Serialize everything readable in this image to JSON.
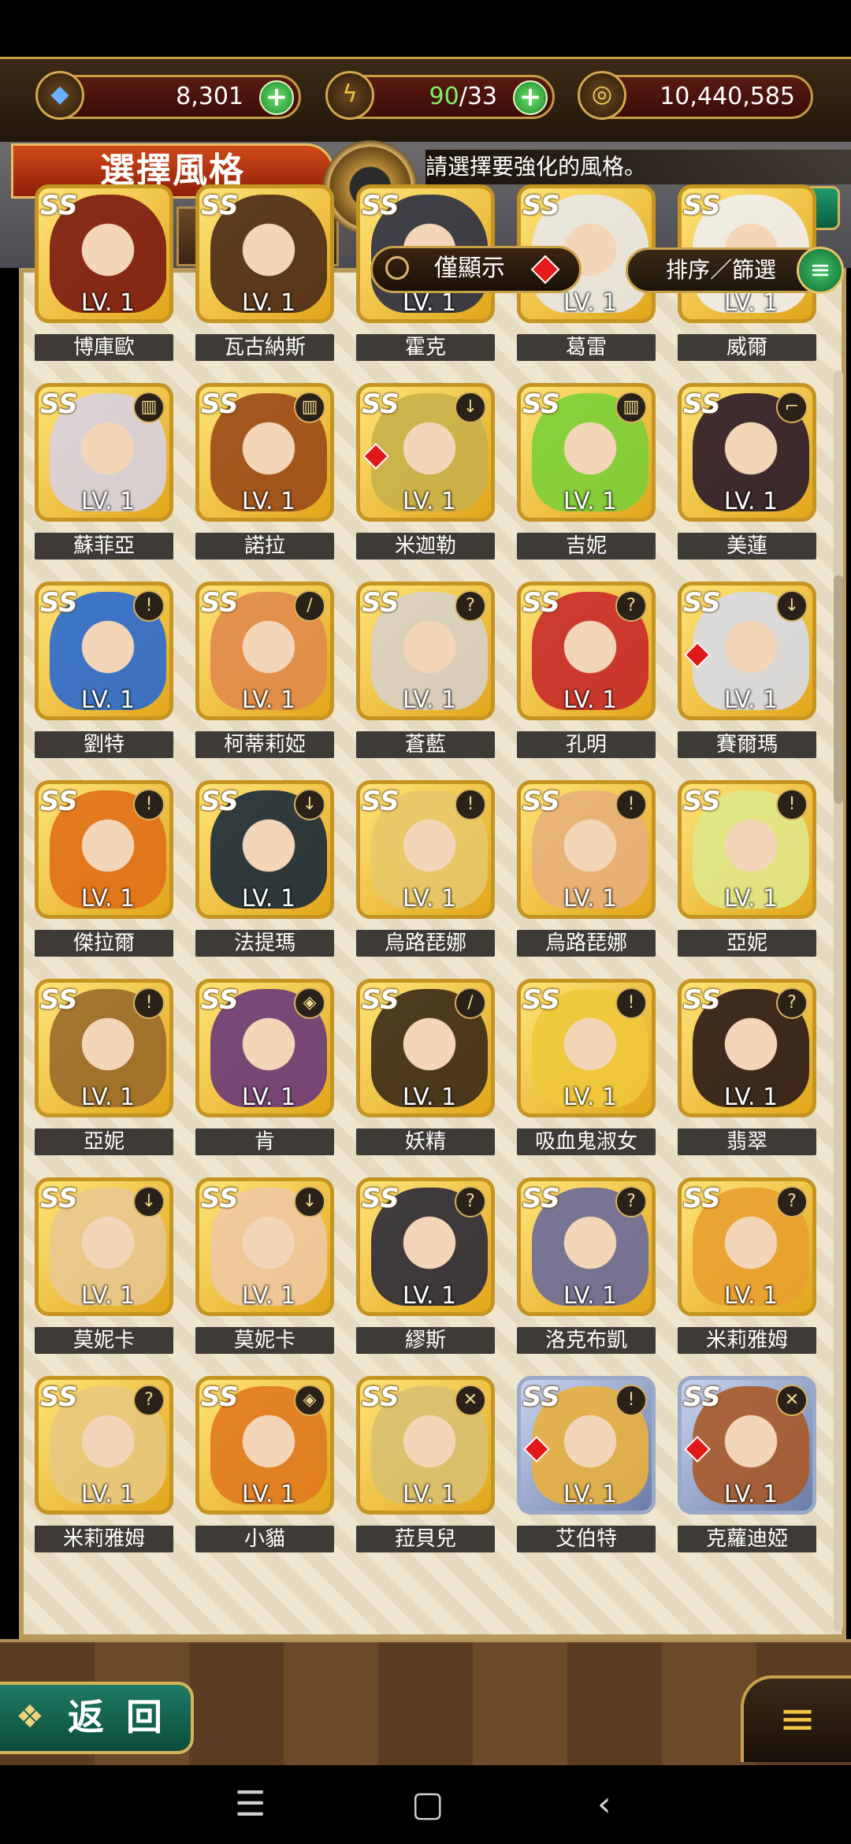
{
  "resources": {
    "gems": "8,301",
    "stamina_current": "90",
    "stamina_max": "/33",
    "gold": "10,440,585",
    "plus": "+"
  },
  "header": {
    "title": "選擇風格",
    "hint": "請選擇要強化的風格。",
    "help": "?"
  },
  "filters": {
    "only_show": "僅顯示",
    "sort_filter": "排序／篩選",
    "menu_icon": "≡"
  },
  "level_label": "LV. 1",
  "rank_label": "SS",
  "characters": [
    {
      "name": "博庫歐",
      "hair": "#7a1a12",
      "class": "",
      "frame": "gold",
      "mark": false
    },
    {
      "name": "瓦古納斯",
      "hair": "#4a2a18",
      "class": "",
      "frame": "gold",
      "mark": false
    },
    {
      "name": "霍克",
      "hair": "#2a2f44",
      "class": "",
      "frame": "gold",
      "mark": false
    },
    {
      "name": "葛雷",
      "hair": "#e8e8e8",
      "class": "",
      "frame": "gold",
      "mark": false
    },
    {
      "name": "威爾",
      "hair": "#f0f0f0",
      "class": "",
      "frame": "gold",
      "mark": false
    },
    {
      "name": "蘇菲亞",
      "hair": "#d8d2e0",
      "class": "▥",
      "frame": "gold",
      "mark": false
    },
    {
      "name": "諾拉",
      "hair": "#9a4a18",
      "class": "▥",
      "frame": "gold",
      "mark": false
    },
    {
      "name": "米迦勒",
      "hair": "#c8b04a",
      "class": "↓",
      "frame": "gold",
      "mark": true
    },
    {
      "name": "吉妮",
      "hair": "#7ccf3a",
      "class": "▥",
      "frame": "gold",
      "mark": false
    },
    {
      "name": "美蓮",
      "hair": "#2a1a2a",
      "class": "⌐",
      "frame": "gold",
      "mark": false
    },
    {
      "name": "劉特",
      "hair": "#2a6ad0",
      "class": "!",
      "frame": "gold",
      "mark": false
    },
    {
      "name": "柯蒂莉婭",
      "hair": "#e08a4a",
      "class": "/",
      "frame": "gold",
      "mark": false
    },
    {
      "name": "蒼藍",
      "hair": "#d8d0c8",
      "class": "?",
      "frame": "gold",
      "mark": false
    },
    {
      "name": "孔明",
      "hair": "#c82a2a",
      "class": "?",
      "frame": "gold",
      "mark": false
    },
    {
      "name": "賽爾瑪",
      "hair": "#d8dce8",
      "class": "↓",
      "frame": "gold",
      "mark": true
    },
    {
      "name": "傑拉爾",
      "hair": "#e0701a",
      "class": "!",
      "frame": "gold",
      "mark": false
    },
    {
      "name": "法提瑪",
      "hair": "#1a2a3a",
      "class": "↓",
      "frame": "gold",
      "mark": false
    },
    {
      "name": "烏路琵娜",
      "hair": "#e8c86a",
      "class": "!",
      "frame": "gold",
      "mark": false
    },
    {
      "name": "烏路琵娜",
      "hair": "#e8b07a",
      "class": "!",
      "frame": "gold",
      "mark": false
    },
    {
      "name": "亞妮",
      "hair": "#e0e88a",
      "class": "!",
      "frame": "gold",
      "mark": false
    },
    {
      "name": "亞妮",
      "hair": "#9a6a2a",
      "class": "!",
      "frame": "gold",
      "mark": false
    },
    {
      "name": "肯",
      "hair": "#6a3a7a",
      "class": "◈",
      "frame": "gold",
      "mark": false
    },
    {
      "name": "妖精",
      "hair": "#3a2a1a",
      "class": "/",
      "frame": "gold",
      "mark": false
    },
    {
      "name": "吸血鬼淑女",
      "hair": "#f0c83a",
      "class": "!",
      "frame": "gold",
      "mark": false
    },
    {
      "name": "翡翠",
      "hair": "#2a1a18",
      "class": "?",
      "frame": "gold",
      "mark": false
    },
    {
      "name": "莫妮卡",
      "hair": "#e8c890",
      "class": "↓",
      "frame": "gold",
      "mark": false
    },
    {
      "name": "莫妮卡",
      "hair": "#f0c8a0",
      "class": "↓",
      "frame": "gold",
      "mark": false
    },
    {
      "name": "繆斯",
      "hair": "#2a2a3a",
      "class": "?",
      "frame": "gold",
      "mark": false
    },
    {
      "name": "洛克布凱",
      "hair": "#6a6a9a",
      "class": "?",
      "frame": "gold",
      "mark": false
    },
    {
      "name": "米莉雅姆",
      "hair": "#e8a030",
      "class": "?",
      "frame": "gold",
      "mark": false
    },
    {
      "name": "米莉雅姆",
      "hair": "#e8c880",
      "class": "?",
      "frame": "gold",
      "mark": false
    },
    {
      "name": "小貓",
      "hair": "#e07a20",
      "class": "◈",
      "frame": "gold",
      "mark": false
    },
    {
      "name": "菈貝兒",
      "hair": "#d8c070",
      "class": "✕",
      "frame": "gold",
      "mark": false
    },
    {
      "name": "艾伯特",
      "hair": "#e8b040",
      "class": "!",
      "frame": "silver",
      "mark": true
    },
    {
      "name": "克蘿迪婭",
      "hair": "#a85a2a",
      "class": "✕",
      "frame": "silver",
      "mark": true
    }
  ],
  "footer": {
    "back": "返 回",
    "back_arrow": "❖",
    "menu": "≡"
  },
  "system_nav": {
    "recents": "☰",
    "home": "▢",
    "back": "‹"
  },
  "colors": {
    "gold_frame": "#c59422",
    "panel_bg": "#efe6cf",
    "accent_red": "#e21b1b",
    "green_button": "#1b8a2a"
  }
}
